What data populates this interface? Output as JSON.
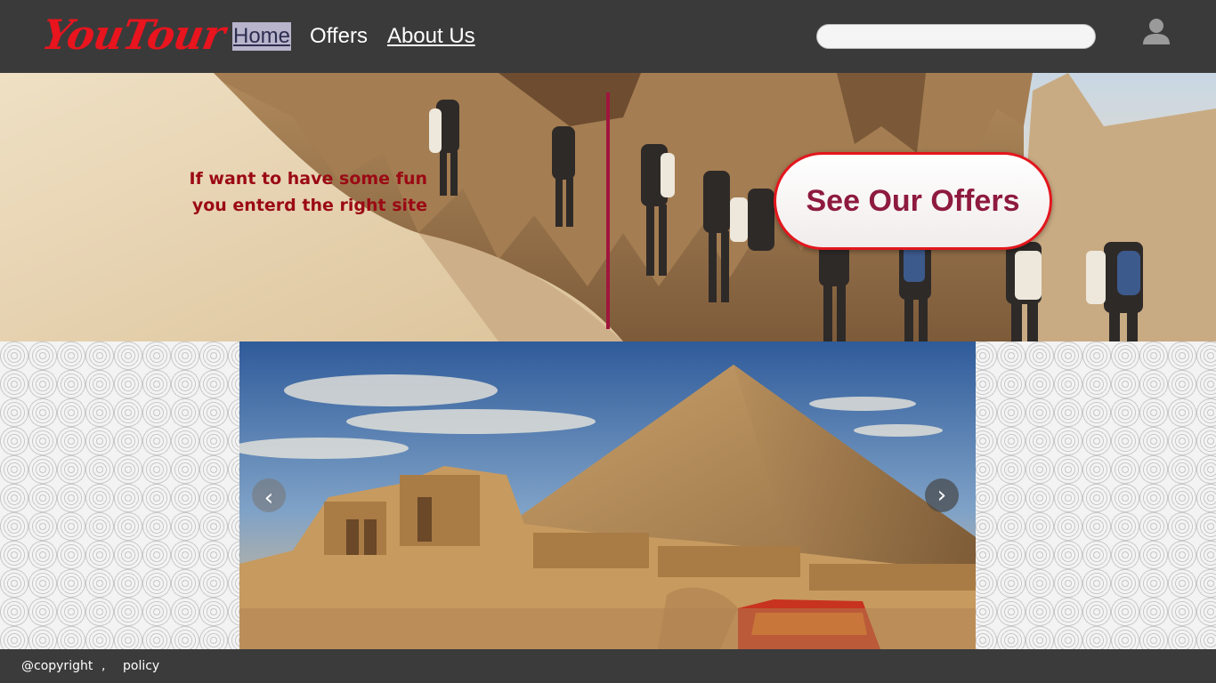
{
  "header": {
    "logo": "YouTour",
    "nav": [
      {
        "label": "Home"
      },
      {
        "label": "Offers"
      },
      {
        "label": "About Us"
      }
    ],
    "search": {
      "value": "",
      "placeholder": ""
    },
    "user_icon": "user-avatar-icon"
  },
  "hero": {
    "text_line1": "If want to have some fun",
    "text_line2": "you enterd the right site",
    "cta_label": "See Our Offers"
  },
  "slider": {
    "prev_label": "‹",
    "next_label": "›"
  },
  "footer": {
    "copyright": "@copyright",
    "separator": ",",
    "policy": "policy"
  },
  "colors": {
    "header_bg": "#3a3a3a",
    "logo": "#e8141e",
    "hero_text": "#9b0a14",
    "divider": "#a0153e",
    "cta_border": "#e3161d",
    "cta_text": "#8e1a3f",
    "footer_bg": "#3b3b3b"
  }
}
